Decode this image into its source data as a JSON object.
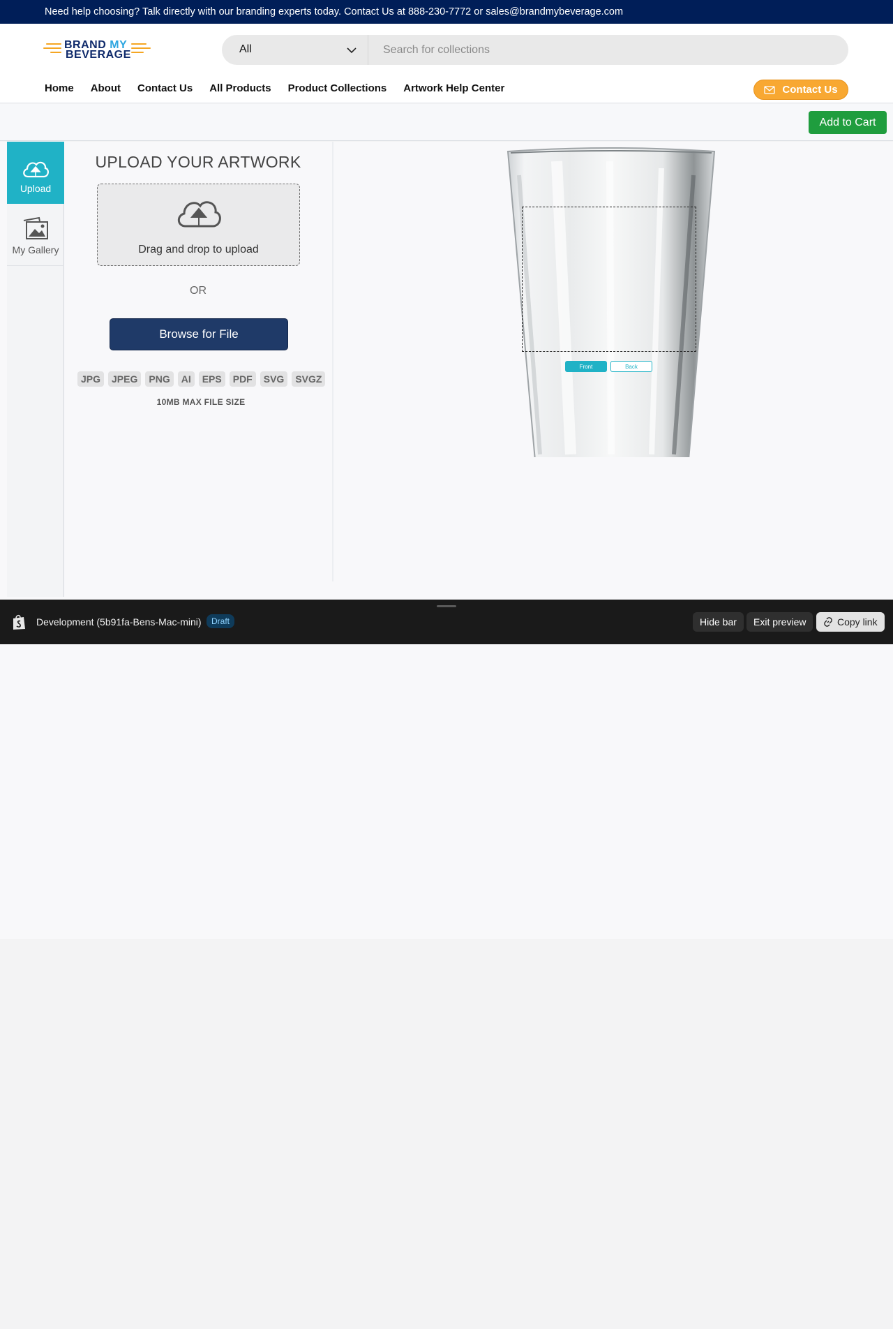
{
  "topbar": {
    "text": "Need help choosing? Talk directly with our branding experts today. Contact Us at 888-230-7772 or sales@brandmybeverage.com"
  },
  "logo": {
    "line1_a": "BRAND",
    "line1_b": "MY",
    "line2": "BEVERAGE"
  },
  "search": {
    "category": "All",
    "placeholder": "Search for collections"
  },
  "nav": [
    "Home",
    "About",
    "Contact Us",
    "All Products",
    "Product Collections",
    "Artwork Help Center"
  ],
  "contact_button": "Contact Us",
  "cart": {
    "add_label": "Add to Cart"
  },
  "rail": {
    "upload": "Upload",
    "gallery": "My Gallery"
  },
  "upload_panel": {
    "title": "UPLOAD YOUR ARTWORK",
    "dropzone": "Drag and drop to upload",
    "or": "OR",
    "browse": "Browse for File",
    "file_types": [
      "JPG",
      "JPEG",
      "PNG",
      "AI",
      "EPS",
      "PDF",
      "SVG",
      "SVGZ"
    ],
    "max_size": "10MB MAX FILE SIZE"
  },
  "canvas": {
    "front": "Front",
    "back": "Back"
  },
  "preview_bar": {
    "env": "Development (5b91fa-Bens-Mac-mini)",
    "badge": "Draft",
    "hide": "Hide bar",
    "exit": "Exit preview",
    "copy": "Copy link"
  },
  "colors": {
    "navy": "#001e58",
    "teal": "#20b2c6",
    "orange": "#f8a832",
    "green": "#1f9d3e",
    "browse": "#1f3a68"
  }
}
